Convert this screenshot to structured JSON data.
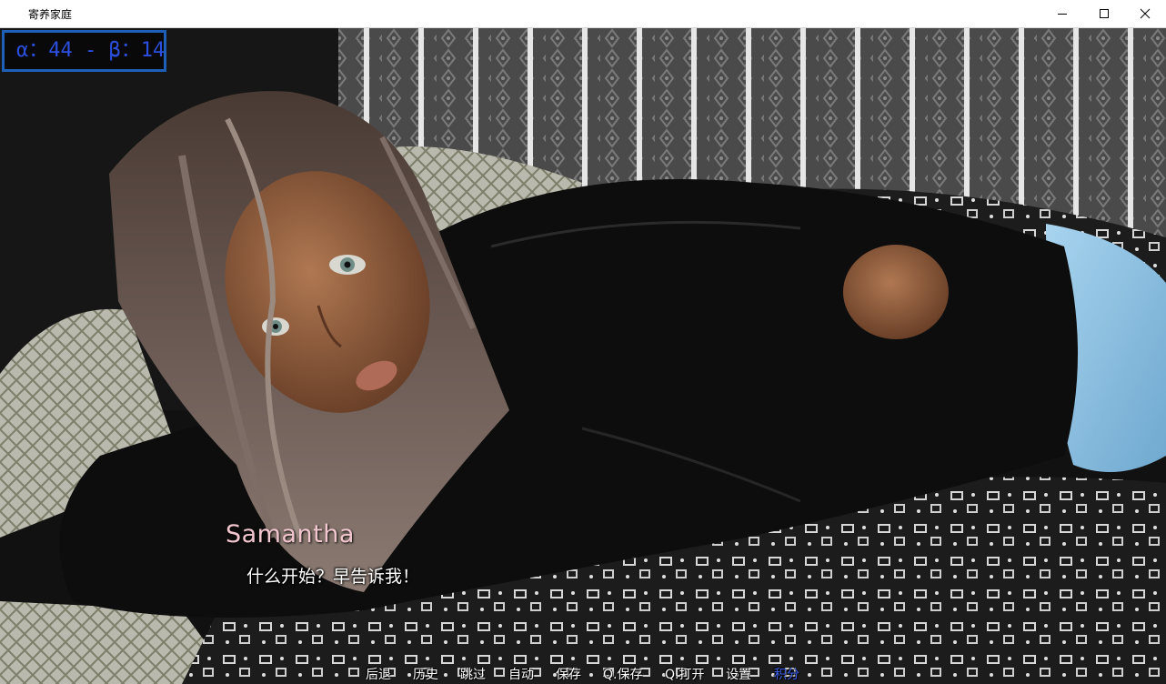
{
  "window": {
    "title": "寄养家庭"
  },
  "stats": {
    "text": "α：44 - β：14"
  },
  "dialogue": {
    "speaker": "Samantha",
    "line": "什么开始？早告诉我！"
  },
  "quick_menu": [
    {
      "label": "后退"
    },
    {
      "label": "历史"
    },
    {
      "label": "跳过"
    },
    {
      "label": "自动"
    },
    {
      "label": "保存"
    },
    {
      "label": "Q.保存"
    },
    {
      "label": "Q.打开"
    },
    {
      "label": "设置"
    },
    {
      "label": "积分"
    }
  ],
  "colors": {
    "stats_text": "#2c4fe0",
    "stats_border": "#1e5fb8",
    "speaker_name": "#f2c6cf",
    "active_menu": "#3a5fe6"
  }
}
